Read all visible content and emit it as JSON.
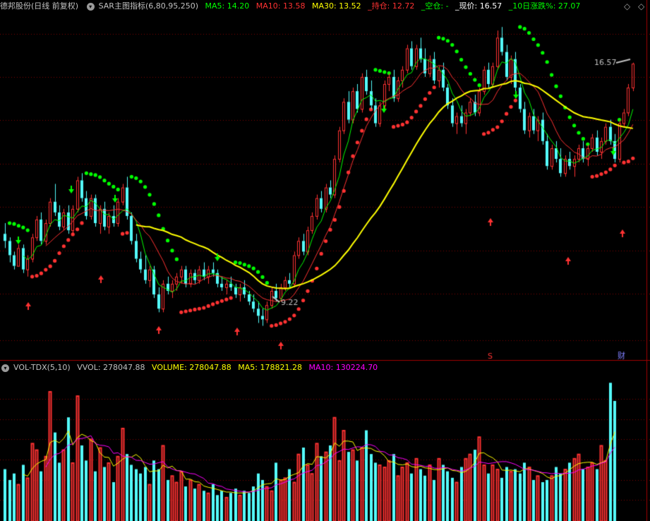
{
  "header": {
    "title": "德邦股份(日线 前复权)",
    "indicator": "SAR主图指标(6,80,95,250)",
    "ma5": "MA5: 14.20",
    "ma10": "MA10: 13.58",
    "ma30": "MA30: 13.52",
    "hold": "_持仓: 12.72",
    "empty": "_空仓: -",
    "price": "_现价: 16.57",
    "chg": "_10日涨跌%: 27.07",
    "diamond": "◇",
    "diamond2": "◇"
  },
  "vol_header": {
    "name": "VOL-TDX(5,10)",
    "vvol": "VVOL: 278047.88",
    "volume": "VOLUME: 278047.88",
    "ma5": "MA5: 178821.28",
    "ma10": "MA10: 130224.70"
  },
  "colors": {
    "bg": "#000000",
    "up": "#ff3232",
    "down": "#54fcfc",
    "ma5": "#ffffff",
    "ma10": "#ff3232",
    "ma30": "#ffff00",
    "sar_up": "#ff3232",
    "sar_dn": "#00ff00",
    "grid": "#800000",
    "yellow": "#ffff00",
    "magenta": "#ff00ff"
  },
  "chart_data": {
    "type": "candlestick",
    "price_annotations": {
      "high": "16.57",
      "low": "9.22"
    },
    "markers": {
      "s": "S",
      "cai": "财"
    },
    "candles": [
      [
        11.8,
        12.1,
        11.4,
        11.6
      ],
      [
        11.6,
        11.7,
        11.0,
        11.2
      ],
      [
        11.2,
        11.3,
        10.8,
        10.9
      ],
      [
        10.9,
        11.5,
        10.9,
        11.4
      ],
      [
        11.4,
        11.5,
        10.7,
        10.8
      ],
      [
        10.8,
        11.2,
        10.6,
        11.1
      ],
      [
        11.1,
        11.8,
        11.0,
        11.7
      ],
      [
        11.7,
        12.3,
        11.6,
        12.2
      ],
      [
        12.2,
        12.4,
        11.5,
        11.6
      ],
      [
        11.6,
        12.2,
        11.5,
        12.1
      ],
      [
        12.1,
        12.8,
        12.0,
        12.7
      ],
      [
        12.7,
        13.2,
        12.3,
        12.4
      ],
      [
        12.4,
        12.6,
        11.9,
        12.0
      ],
      [
        12.0,
        12.5,
        11.9,
        12.4
      ],
      [
        12.4,
        12.6,
        11.8,
        11.9
      ],
      [
        11.9,
        12.6,
        11.8,
        12.5
      ],
      [
        12.5,
        13.4,
        12.4,
        13.3
      ],
      [
        13.3,
        13.5,
        12.7,
        12.8
      ],
      [
        12.8,
        13.0,
        12.2,
        12.3
      ],
      [
        12.3,
        12.9,
        12.2,
        12.8
      ],
      [
        12.8,
        12.9,
        12.0,
        12.1
      ],
      [
        12.1,
        12.6,
        11.8,
        12.5
      ],
      [
        12.5,
        12.7,
        11.9,
        12.0
      ],
      [
        12.0,
        12.4,
        11.8,
        12.3
      ],
      [
        12.3,
        12.6,
        12.0,
        12.1
      ],
      [
        12.1,
        12.8,
        12.0,
        12.7
      ],
      [
        12.7,
        13.2,
        12.6,
        13.1
      ],
      [
        13.1,
        13.4,
        12.2,
        12.3
      ],
      [
        12.3,
        12.4,
        11.5,
        11.6
      ],
      [
        11.6,
        11.8,
        11.0,
        11.1
      ],
      [
        11.1,
        11.3,
        10.7,
        10.8
      ],
      [
        10.8,
        11.2,
        10.4,
        10.5
      ],
      [
        10.5,
        10.9,
        10.3,
        10.8
      ],
      [
        10.8,
        10.9,
        10.0,
        10.1
      ],
      [
        10.1,
        10.3,
        9.6,
        9.7
      ],
      [
        9.7,
        10.5,
        9.6,
        10.4
      ],
      [
        10.4,
        10.6,
        10.1,
        10.2
      ],
      [
        10.2,
        10.5,
        10.0,
        10.4
      ],
      [
        10.4,
        10.7,
        10.2,
        10.6
      ],
      [
        10.6,
        10.9,
        10.4,
        10.8
      ],
      [
        10.8,
        10.9,
        10.3,
        10.4
      ],
      [
        10.4,
        10.8,
        10.3,
        10.7
      ],
      [
        10.7,
        10.8,
        10.4,
        10.5
      ],
      [
        10.5,
        10.9,
        10.4,
        10.8
      ],
      [
        10.8,
        11.0,
        10.5,
        10.6
      ],
      [
        10.6,
        10.9,
        10.4,
        10.8
      ],
      [
        10.8,
        11.0,
        10.6,
        10.7
      ],
      [
        10.7,
        10.8,
        10.3,
        10.4
      ],
      [
        10.4,
        10.6,
        10.2,
        10.3
      ],
      [
        10.3,
        10.5,
        10.1,
        10.4
      ],
      [
        10.4,
        10.6,
        10.2,
        10.3
      ],
      [
        10.3,
        10.4,
        10.0,
        10.1
      ],
      [
        10.1,
        10.4,
        9.9,
        10.3
      ],
      [
        10.3,
        10.5,
        10.0,
        10.1
      ],
      [
        10.1,
        10.2,
        9.8,
        9.9
      ],
      [
        9.9,
        10.1,
        9.6,
        9.7
      ],
      [
        9.7,
        9.9,
        9.3,
        9.5
      ],
      [
        9.5,
        9.7,
        9.22,
        9.4
      ],
      [
        9.4,
        9.9,
        9.3,
        9.8
      ],
      [
        9.8,
        10.3,
        9.7,
        10.2
      ],
      [
        10.2,
        10.4,
        9.9,
        10.0
      ],
      [
        10.0,
        10.4,
        9.9,
        10.3
      ],
      [
        10.3,
        10.6,
        10.2,
        10.5
      ],
      [
        10.5,
        10.7,
        10.3,
        10.4
      ],
      [
        10.4,
        11.3,
        10.3,
        11.2
      ],
      [
        11.2,
        11.7,
        11.1,
        11.6
      ],
      [
        11.6,
        11.8,
        11.2,
        11.3
      ],
      [
        11.3,
        12.0,
        11.2,
        11.9
      ],
      [
        11.9,
        12.4,
        11.8,
        12.3
      ],
      [
        12.3,
        12.9,
        12.2,
        12.8
      ],
      [
        12.8,
        13.0,
        12.4,
        12.5
      ],
      [
        12.5,
        13.2,
        12.4,
        13.1
      ],
      [
        13.1,
        13.3,
        12.8,
        12.9
      ],
      [
        12.9,
        14.0,
        12.8,
        13.9
      ],
      [
        13.9,
        14.8,
        13.8,
        14.7
      ],
      [
        14.7,
        15.6,
        14.6,
        15.5
      ],
      [
        15.5,
        15.8,
        14.9,
        15.0
      ],
      [
        15.0,
        15.9,
        14.9,
        15.8
      ],
      [
        15.8,
        16.0,
        15.2,
        15.3
      ],
      [
        15.3,
        16.3,
        15.2,
        16.2
      ],
      [
        16.2,
        16.4,
        15.7,
        15.8
      ],
      [
        15.8,
        16.1,
        15.3,
        15.4
      ],
      [
        15.4,
        15.6,
        14.8,
        14.9
      ],
      [
        14.9,
        15.5,
        14.8,
        15.4
      ],
      [
        15.4,
        16.1,
        15.3,
        16.0
      ],
      [
        16.0,
        16.3,
        15.8,
        16.2
      ],
      [
        16.2,
        16.4,
        15.5,
        15.6
      ],
      [
        15.6,
        16.2,
        15.5,
        16.1
      ],
      [
        16.1,
        16.5,
        15.9,
        16.4
      ],
      [
        16.4,
        17.1,
        16.3,
        17.0
      ],
      [
        17.0,
        17.2,
        16.4,
        16.5
      ],
      [
        16.5,
        17.1,
        16.4,
        17.0
      ],
      [
        17.0,
        17.3,
        16.6,
        16.7
      ],
      [
        16.7,
        17.0,
        16.2,
        16.3
      ],
      [
        16.3,
        16.8,
        16.2,
        16.7
      ],
      [
        16.7,
        16.9,
        16.0,
        16.1
      ],
      [
        16.1,
        16.5,
        15.9,
        16.4
      ],
      [
        16.4,
        16.6,
        15.8,
        15.9
      ],
      [
        15.9,
        16.0,
        15.3,
        15.4
      ],
      [
        15.4,
        15.6,
        14.8,
        14.9
      ],
      [
        14.9,
        15.2,
        14.6,
        15.1
      ],
      [
        15.1,
        15.4,
        14.8,
        14.9
      ],
      [
        14.9,
        15.3,
        14.6,
        15.2
      ],
      [
        15.2,
        15.6,
        15.1,
        15.5
      ],
      [
        15.5,
        15.7,
        15.1,
        15.2
      ],
      [
        15.2,
        15.9,
        15.1,
        15.8
      ],
      [
        15.8,
        16.5,
        15.7,
        16.4
      ],
      [
        16.4,
        16.6,
        15.9,
        16.0
      ],
      [
        16.0,
        16.6,
        15.9,
        16.5
      ],
      [
        16.5,
        17.5,
        16.4,
        17.3
      ],
      [
        17.3,
        17.6,
        16.8,
        16.9
      ],
      [
        16.9,
        17.1,
        16.1,
        16.2
      ],
      [
        16.2,
        16.8,
        16.0,
        16.7
      ],
      [
        16.7,
        16.9,
        15.8,
        15.9
      ],
      [
        15.9,
        16.0,
        15.2,
        15.3
      ],
      [
        15.3,
        15.5,
        14.6,
        14.7
      ],
      [
        14.7,
        15.2,
        14.5,
        15.1
      ],
      [
        15.1,
        15.3,
        14.6,
        14.7
      ],
      [
        14.7,
        15.1,
        14.4,
        15.0
      ],
      [
        15.0,
        15.2,
        14.3,
        14.4
      ],
      [
        14.4,
        14.6,
        13.6,
        13.7
      ],
      [
        13.7,
        14.3,
        13.6,
        14.2
      ],
      [
        14.2,
        14.4,
        13.8,
        13.9
      ],
      [
        13.9,
        14.2,
        13.4,
        13.5
      ],
      [
        13.5,
        14.0,
        13.4,
        13.9
      ],
      [
        13.9,
        14.1,
        13.6,
        13.7
      ],
      [
        13.7,
        14.0,
        13.4,
        13.9
      ],
      [
        13.9,
        14.3,
        13.8,
        14.2
      ],
      [
        14.2,
        14.4,
        13.8,
        13.9
      ],
      [
        13.9,
        14.3,
        13.7,
        14.2
      ],
      [
        14.2,
        14.6,
        14.1,
        14.5
      ],
      [
        14.5,
        14.7,
        14.0,
        14.1
      ],
      [
        14.1,
        14.5,
        13.9,
        14.4
      ],
      [
        14.4,
        14.9,
        14.3,
        14.8
      ],
      [
        14.8,
        15.0,
        14.3,
        14.4
      ],
      [
        14.4,
        14.6,
        13.8,
        13.9
      ],
      [
        13.9,
        15.0,
        13.8,
        14.9
      ],
      [
        14.9,
        15.3,
        14.8,
        15.2
      ],
      [
        15.2,
        16.0,
        15.1,
        15.9
      ],
      [
        15.9,
        16.6,
        15.8,
        16.57
      ]
    ],
    "volume": [
      12.0,
      9.5,
      11.0,
      8.5,
      13.0,
      10.0,
      18.0,
      16.5,
      11.5,
      15.0,
      30.0,
      20.5,
      13.5,
      16.5,
      24.0,
      13.5,
      29.0,
      17.5,
      14.0,
      19.0,
      11.5,
      17.0,
      12.5,
      13.5,
      9.0,
      15.0,
      21.5,
      15.5,
      13.0,
      12.0,
      11.0,
      12.5,
      8.5,
      14.0,
      12.0,
      17.5,
      9.5,
      10.5,
      9.0,
      11.5,
      8.0,
      9.5,
      7.5,
      8.5,
      7.0,
      6.5,
      8.5,
      6.0,
      7.0,
      5.5,
      6.5,
      7.5,
      6.0,
      7.0,
      6.5,
      8.0,
      11.0,
      9.5,
      8.0,
      7.0,
      13.5,
      9.5,
      10.0,
      12.0,
      9.0,
      15.5,
      17.0,
      13.0,
      11.0,
      18.0,
      15.0,
      16.0,
      17.5,
      24.0,
      14.0,
      21.0,
      16.0,
      16.5,
      14.0,
      17.0,
      21.0,
      15.5,
      13.5,
      13.0,
      12.5,
      14.0,
      15.5,
      10.5,
      12.5,
      13.5,
      11.0,
      14.5,
      12.0,
      10.5,
      13.0,
      9.5,
      14.5,
      13.0,
      11.5,
      10.0,
      9.0,
      12.5,
      14.5,
      15.5,
      16.5,
      19.5,
      13.0,
      11.0,
      13.0,
      12.0,
      10.0,
      12.5,
      11.5,
      12.0,
      11.0,
      13.5,
      12.5,
      9.5,
      10.5,
      9.0,
      9.5,
      10.5,
      12.5,
      11.0,
      12.0,
      13.5,
      14.5,
      15.5,
      12.0,
      12.5,
      13.5,
      12.0,
      17.5,
      14.0,
      32.0,
      27.8
    ]
  }
}
